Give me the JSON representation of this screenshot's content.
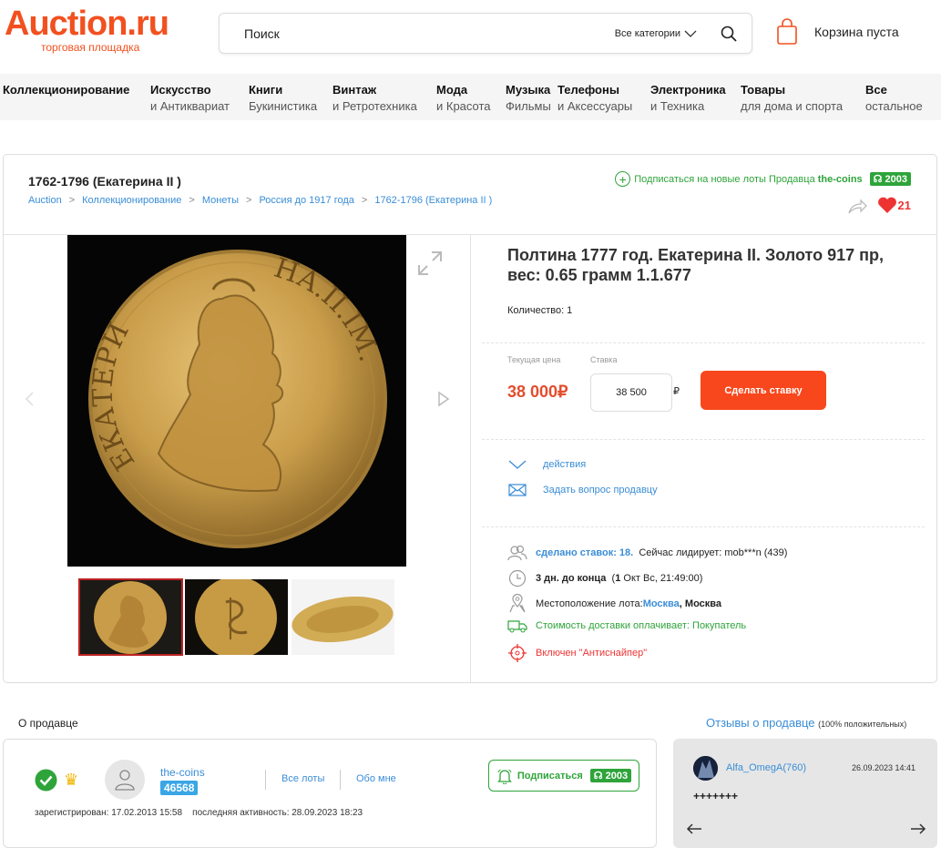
{
  "header": {
    "logo_text": "Auction.ru",
    "logo_sub": "торговая площадка",
    "search_placeholder": "Поиск",
    "category_select": "Все категории",
    "cart_label": "Корзина пуста",
    "brand_color": "#f2501f"
  },
  "nav": {
    "items": [
      {
        "l1": "Коллекционирование",
        "l2": ""
      },
      {
        "l1": "Искусство",
        "l2": "и Антиквариат"
      },
      {
        "l1": "Книги",
        "l2": "Букинистика"
      },
      {
        "l1": "Винтаж",
        "l2": "и Ретротехника"
      },
      {
        "l1": "Мода",
        "l2": "и Красота"
      },
      {
        "l1": "Музыка",
        "l2": "Фильмы"
      },
      {
        "l1": "Телефоны",
        "l2": "и Аксессуары"
      },
      {
        "l1": "Электроника",
        "l2": "и Техника"
      },
      {
        "l1": "Товары",
        "l2": "для дома и спорта"
      },
      {
        "l1": "Все",
        "l2": "остальное"
      }
    ]
  },
  "lot": {
    "category_title": "1762-1796 (Екатерина II )",
    "breadcrumbs": [
      "Auction",
      "Коллекционирование",
      "Монеты",
      "Россия до 1917 года",
      "1762-1796 (Екатерина II )"
    ],
    "subscribe_text": "Подписаться на новые лоты Продавца",
    "seller_name": "the-coins",
    "seller_subscribers": "2003",
    "favorites_count": "21",
    "title": "Полтина 1777 год. Екатерина II. Золото 917 пр, вес: 0.65 грамм 1.1.677",
    "quantity": "Количество: 1",
    "current_price_label": "Текущая цена",
    "bid_label": "Ставка",
    "current_price": "38 000₽",
    "bid_value": "38 500",
    "currency": "₽",
    "bid_button": "Сделать ставку",
    "coin_legend_left": "ЕКАТЕРИ",
    "coin_legend_right": "НА.II.IМ.",
    "thumb_count": 3,
    "active_thumb": 0
  },
  "actions": {
    "actions_label": "действия",
    "ask_label": "Задать вопрос продавцу"
  },
  "info": {
    "bids_made": "сделано ставок: 18.",
    "leader": "Сейчас лидирует: mob***n (439)",
    "time_left": "3 дн. до конца",
    "end_date_num": "1",
    "end_date_rest": "Окт Вс, 21:49:00",
    "location_label": "Местоположение лота:",
    "location_city": "Москва",
    "location_region": ", Москва",
    "shipping": "Стоимость доставки оплачивает: Покупатель",
    "antisniper": "Включен \"Антиснайпер\""
  },
  "seller": {
    "section_title": "О продавце",
    "name": "the-coins",
    "rating": "46568",
    "all_lots": "Все лоты",
    "about": "Обо мне",
    "subscribe": "Подписаться",
    "subscribers": "2003",
    "registered": "зарегистрирован: 17.02.2013 15:58",
    "last_activity": "последняя активность: 28.09.2023 18:23"
  },
  "reviews": {
    "title": "Отзывы о продавце",
    "summary": "(100% положительных)",
    "user": "Alfa_OmegA(760)",
    "date": "26.09.2023 14:41",
    "text": "+++++++"
  }
}
